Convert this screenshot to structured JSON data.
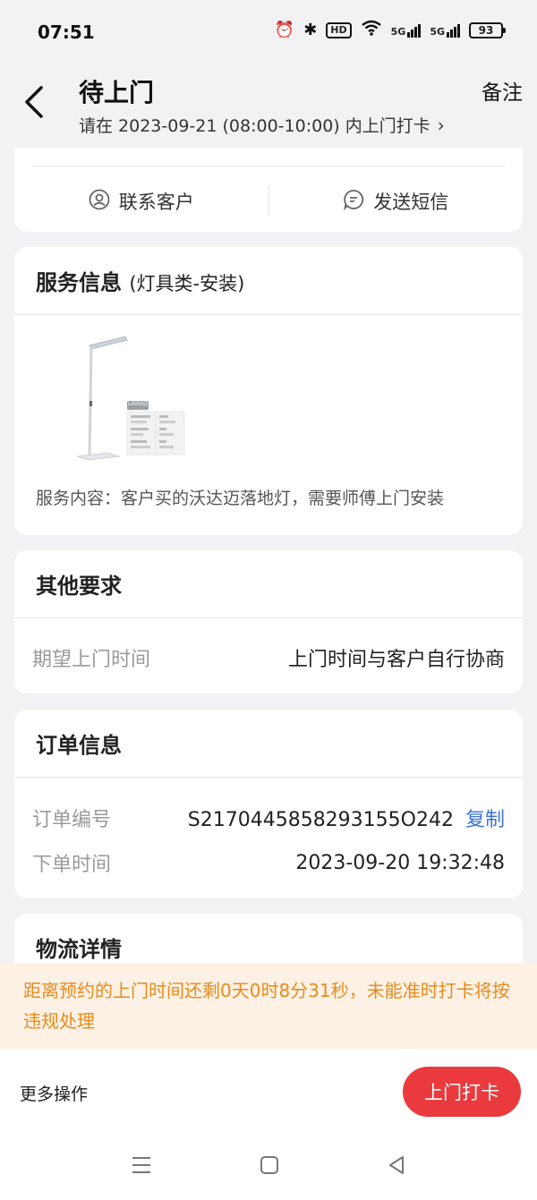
{
  "status_bar": {
    "time": "07:51",
    "icons": [
      "alarm-icon",
      "bluetooth-icon",
      "hd-icon",
      "wifi-icon",
      "signal-5g-icon",
      "signal-5g-icon"
    ],
    "hd_label": "HD",
    "net1": "5G",
    "net2": "5G",
    "battery": "93"
  },
  "header": {
    "title": "待上门",
    "subtitle": "请在 2023-09-21 (08:00-10:00) 内上门打卡",
    "note": "备注"
  },
  "contact": {
    "contact_customer": "联系客户",
    "send_sms": "发送短信"
  },
  "service": {
    "title": "服务信息",
    "category": "(灯具类-安装)",
    "content": "服务内容：客户买的沃达迈落地灯，需要师傅上门安装",
    "image_label": "LAVIGO"
  },
  "requirements": {
    "title": "其他要求",
    "rows": [
      {
        "label": "期望上门时间",
        "value": "上门时间与客户自行协商"
      }
    ]
  },
  "order": {
    "title": "订单信息",
    "number_label": "订单编号",
    "number_value": "S2170445858293155O242",
    "copy": "复制",
    "time_label": "下单时间",
    "time_value": "2023-09-20 19:32:48"
  },
  "logistics": {
    "title": "物流详情"
  },
  "notice": {
    "text": "距离预约的上门时间还剩0天0时8分31秒，未能准时打卡将按违规处理"
  },
  "bottom": {
    "more": "更多操作",
    "checkin": "上门打卡"
  },
  "colors": {
    "accent_red": "#ea3a3e",
    "notice_orange": "#ea8a1c",
    "link_blue": "#3b73d6"
  }
}
